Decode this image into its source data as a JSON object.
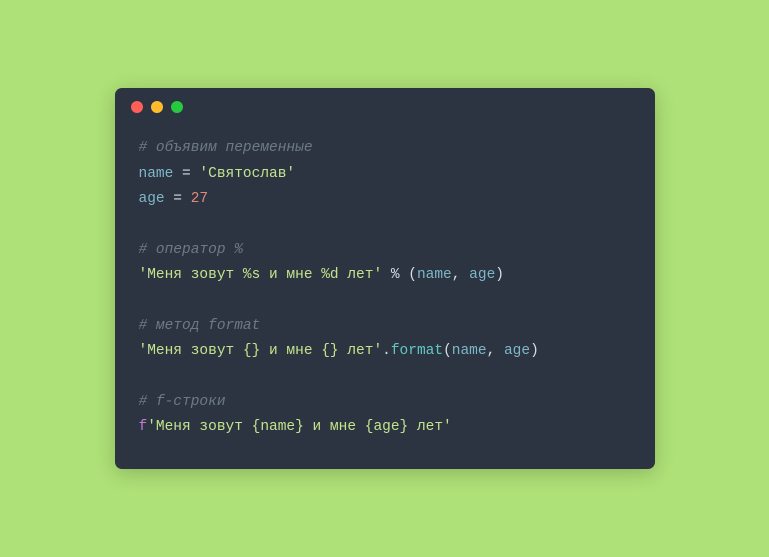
{
  "code": {
    "lines": [
      [
        {
          "cls": "tok-comment",
          "text": "# объявим переменные"
        }
      ],
      [
        {
          "cls": "tok-var",
          "text": "name"
        },
        {
          "cls": "tok-default",
          "text": " = "
        },
        {
          "cls": "tok-string",
          "text": "'Святослав'"
        }
      ],
      [
        {
          "cls": "tok-var",
          "text": "age"
        },
        {
          "cls": "tok-default",
          "text": " = "
        },
        {
          "cls": "tok-number",
          "text": "27"
        }
      ],
      [],
      [
        {
          "cls": "tok-comment",
          "text": "# оператор %"
        }
      ],
      [
        {
          "cls": "tok-string",
          "text": "'Меня зовут %s и мне %d лет'"
        },
        {
          "cls": "tok-default",
          "text": " % ("
        },
        {
          "cls": "tok-var",
          "text": "name"
        },
        {
          "cls": "tok-punct",
          "text": ", "
        },
        {
          "cls": "tok-var",
          "text": "age"
        },
        {
          "cls": "tok-punct",
          "text": ")"
        }
      ],
      [],
      [
        {
          "cls": "tok-comment",
          "text": "# метод format"
        }
      ],
      [
        {
          "cls": "tok-string",
          "text": "'Меня зовут {} и мне {} лет'"
        },
        {
          "cls": "tok-punct",
          "text": "."
        },
        {
          "cls": "tok-func",
          "text": "format"
        },
        {
          "cls": "tok-punct",
          "text": "("
        },
        {
          "cls": "tok-var",
          "text": "name"
        },
        {
          "cls": "tok-punct",
          "text": ", "
        },
        {
          "cls": "tok-var",
          "text": "age"
        },
        {
          "cls": "tok-punct",
          "text": ")"
        }
      ],
      [],
      [
        {
          "cls": "tok-comment",
          "text": "# f-строки"
        }
      ],
      [
        {
          "cls": "tok-fprefix",
          "text": "f"
        },
        {
          "cls": "tok-string",
          "text": "'Меня зовут {name} и мне {age} лет'"
        }
      ]
    ]
  }
}
